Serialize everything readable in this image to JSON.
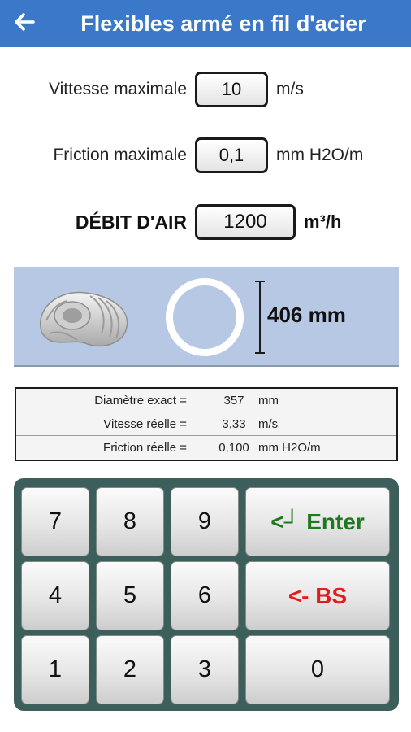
{
  "appbar": {
    "title": "Flexibles armé en fil d'acier"
  },
  "inputs": {
    "max_speed": {
      "label": "Vittesse maximale",
      "value": "10",
      "unit": "m/s"
    },
    "max_friction": {
      "label": "Friction maximale",
      "value": "0,1",
      "unit": "mm H2O/m"
    },
    "air_flow": {
      "label": "DÉBIT D'AIR",
      "value": "1200",
      "unit": "m³/h"
    }
  },
  "duct": {
    "diameter_label": "406 mm"
  },
  "results": [
    {
      "label": "Diamètre exact =",
      "value": "357",
      "unit": "mm"
    },
    {
      "label": "Vitesse réelle =",
      "value": "3,33",
      "unit": "m/s"
    },
    {
      "label": "Friction réelle =",
      "value": "0,100",
      "unit": "mm H2O/m"
    }
  ],
  "keypad": {
    "keys": [
      "7",
      "8",
      "9",
      "4",
      "5",
      "6",
      "1",
      "2",
      "3",
      "0"
    ],
    "enter_label": "<┘ Enter",
    "bs_label": "<- BS"
  },
  "colors": {
    "appbar": "#3b78c9",
    "duct_panel": "#b7c8e4",
    "keypad_bg": "#3c5f5b",
    "enter_text": "#1f7a1f",
    "bs_text": "#e41b1b"
  },
  "icons": {
    "back": "arrow-left-icon"
  }
}
